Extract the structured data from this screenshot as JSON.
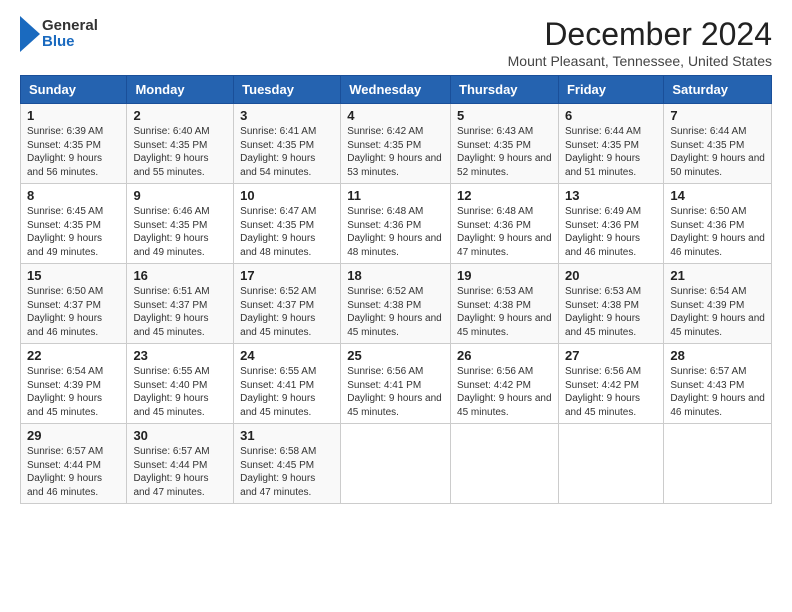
{
  "logo": {
    "general": "General",
    "blue": "Blue"
  },
  "title": "December 2024",
  "location": "Mount Pleasant, Tennessee, United States",
  "days_of_week": [
    "Sunday",
    "Monday",
    "Tuesday",
    "Wednesday",
    "Thursday",
    "Friday",
    "Saturday"
  ],
  "weeks": [
    [
      {
        "day": "1",
        "sunrise": "6:39 AM",
        "sunset": "4:35 PM",
        "daylight": "9 hours and 56 minutes."
      },
      {
        "day": "2",
        "sunrise": "6:40 AM",
        "sunset": "4:35 PM",
        "daylight": "9 hours and 55 minutes."
      },
      {
        "day": "3",
        "sunrise": "6:41 AM",
        "sunset": "4:35 PM",
        "daylight": "9 hours and 54 minutes."
      },
      {
        "day": "4",
        "sunrise": "6:42 AM",
        "sunset": "4:35 PM",
        "daylight": "9 hours and 53 minutes."
      },
      {
        "day": "5",
        "sunrise": "6:43 AM",
        "sunset": "4:35 PM",
        "daylight": "9 hours and 52 minutes."
      },
      {
        "day": "6",
        "sunrise": "6:44 AM",
        "sunset": "4:35 PM",
        "daylight": "9 hours and 51 minutes."
      },
      {
        "day": "7",
        "sunrise": "6:44 AM",
        "sunset": "4:35 PM",
        "daylight": "9 hours and 50 minutes."
      }
    ],
    [
      {
        "day": "8",
        "sunrise": "6:45 AM",
        "sunset": "4:35 PM",
        "daylight": "9 hours and 49 minutes."
      },
      {
        "day": "9",
        "sunrise": "6:46 AM",
        "sunset": "4:35 PM",
        "daylight": "9 hours and 49 minutes."
      },
      {
        "day": "10",
        "sunrise": "6:47 AM",
        "sunset": "4:35 PM",
        "daylight": "9 hours and 48 minutes."
      },
      {
        "day": "11",
        "sunrise": "6:48 AM",
        "sunset": "4:36 PM",
        "daylight": "9 hours and 48 minutes."
      },
      {
        "day": "12",
        "sunrise": "6:48 AM",
        "sunset": "4:36 PM",
        "daylight": "9 hours and 47 minutes."
      },
      {
        "day": "13",
        "sunrise": "6:49 AM",
        "sunset": "4:36 PM",
        "daylight": "9 hours and 46 minutes."
      },
      {
        "day": "14",
        "sunrise": "6:50 AM",
        "sunset": "4:36 PM",
        "daylight": "9 hours and 46 minutes."
      }
    ],
    [
      {
        "day": "15",
        "sunrise": "6:50 AM",
        "sunset": "4:37 PM",
        "daylight": "9 hours and 46 minutes."
      },
      {
        "day": "16",
        "sunrise": "6:51 AM",
        "sunset": "4:37 PM",
        "daylight": "9 hours and 45 minutes."
      },
      {
        "day": "17",
        "sunrise": "6:52 AM",
        "sunset": "4:37 PM",
        "daylight": "9 hours and 45 minutes."
      },
      {
        "day": "18",
        "sunrise": "6:52 AM",
        "sunset": "4:38 PM",
        "daylight": "9 hours and 45 minutes."
      },
      {
        "day": "19",
        "sunrise": "6:53 AM",
        "sunset": "4:38 PM",
        "daylight": "9 hours and 45 minutes."
      },
      {
        "day": "20",
        "sunrise": "6:53 AM",
        "sunset": "4:38 PM",
        "daylight": "9 hours and 45 minutes."
      },
      {
        "day": "21",
        "sunrise": "6:54 AM",
        "sunset": "4:39 PM",
        "daylight": "9 hours and 45 minutes."
      }
    ],
    [
      {
        "day": "22",
        "sunrise": "6:54 AM",
        "sunset": "4:39 PM",
        "daylight": "9 hours and 45 minutes."
      },
      {
        "day": "23",
        "sunrise": "6:55 AM",
        "sunset": "4:40 PM",
        "daylight": "9 hours and 45 minutes."
      },
      {
        "day": "24",
        "sunrise": "6:55 AM",
        "sunset": "4:41 PM",
        "daylight": "9 hours and 45 minutes."
      },
      {
        "day": "25",
        "sunrise": "6:56 AM",
        "sunset": "4:41 PM",
        "daylight": "9 hours and 45 minutes."
      },
      {
        "day": "26",
        "sunrise": "6:56 AM",
        "sunset": "4:42 PM",
        "daylight": "9 hours and 45 minutes."
      },
      {
        "day": "27",
        "sunrise": "6:56 AM",
        "sunset": "4:42 PM",
        "daylight": "9 hours and 45 minutes."
      },
      {
        "day": "28",
        "sunrise": "6:57 AM",
        "sunset": "4:43 PM",
        "daylight": "9 hours and 46 minutes."
      }
    ],
    [
      {
        "day": "29",
        "sunrise": "6:57 AM",
        "sunset": "4:44 PM",
        "daylight": "9 hours and 46 minutes."
      },
      {
        "day": "30",
        "sunrise": "6:57 AM",
        "sunset": "4:44 PM",
        "daylight": "9 hours and 47 minutes."
      },
      {
        "day": "31",
        "sunrise": "6:58 AM",
        "sunset": "4:45 PM",
        "daylight": "9 hours and 47 minutes."
      },
      null,
      null,
      null,
      null
    ]
  ]
}
